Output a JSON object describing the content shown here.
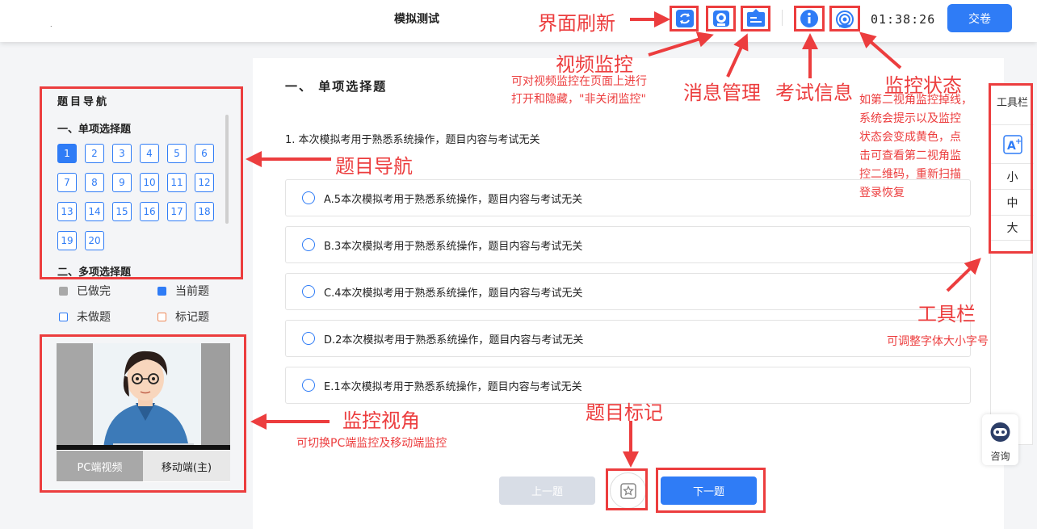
{
  "header": {
    "title": "模拟测试",
    "dot": ".",
    "timer": "01:38:26",
    "submit_label": "交卷",
    "icons": [
      "refresh-icon",
      "camera-icon",
      "message-icon",
      "info-icon",
      "monitor-status-icon"
    ]
  },
  "nav": {
    "title": "题目导航",
    "section1": "一、单项选择题",
    "section2": "二、多项选择题",
    "questions": [
      "1",
      "2",
      "3",
      "4",
      "5",
      "6",
      "7",
      "8",
      "9",
      "10",
      "11",
      "12",
      "13",
      "14",
      "15",
      "16",
      "17",
      "18",
      "19",
      "20"
    ],
    "current": "1"
  },
  "legend": {
    "done": "已做完",
    "current": "当前题",
    "undone": "未做题",
    "marked": "标记题"
  },
  "video": {
    "tab_pc": "PC端视频",
    "tab_mobile": "移动端(主)"
  },
  "question": {
    "section_title": "一、 单项选择题",
    "text": "1. 本次模拟考用于熟悉系统操作，题目内容与考试无关",
    "options": [
      "A.5本次模拟考用于熟悉系统操作，题目内容与考试无关",
      "B.3本次模拟考用于熟悉系统操作，题目内容与考试无关",
      "C.4本次模拟考用于熟悉系统操作，题目内容与考试无关",
      "D.2本次模拟考用于熟悉系统操作，题目内容与考试无关",
      "E.1本次模拟考用于熟悉系统操作，题目内容与考试无关"
    ]
  },
  "buttons": {
    "prev": "上一题",
    "next": "下一题"
  },
  "toolbar": {
    "title": "工具栏",
    "font_small": "小",
    "font_medium": "中",
    "font_large": "大",
    "consult": "咨询"
  },
  "annotations": {
    "refresh": "界面刷新",
    "video": "视频监控",
    "video_note_1": "可对视频监控在页面上进行",
    "video_note_2": "打开和隐藏，\"非关闭监控\"",
    "message": "消息管理",
    "exam_info": "考试信息",
    "monitor_status": "监控状态",
    "monitor_note_1": "如第二视角监控掉线，",
    "monitor_note_2": "系统会提示以及监控",
    "monitor_note_3": "状态会变成黄色，点",
    "monitor_note_4": "击可查看第二视角监",
    "monitor_note_5": "控二维码，重新扫描",
    "monitor_note_6": "登录恢复",
    "nav": "题目导航",
    "monitor_view": "监控视角",
    "monitor_view_note": "可切换PC端监控及移动端监控",
    "toolbar": "工具栏",
    "toolbar_note": "可调整字体大小字号",
    "mark": "题目标记"
  },
  "colors": {
    "accent": "#2f7cf6",
    "annotation": "#ec3d3e",
    "disabled": "#d8dde6"
  }
}
